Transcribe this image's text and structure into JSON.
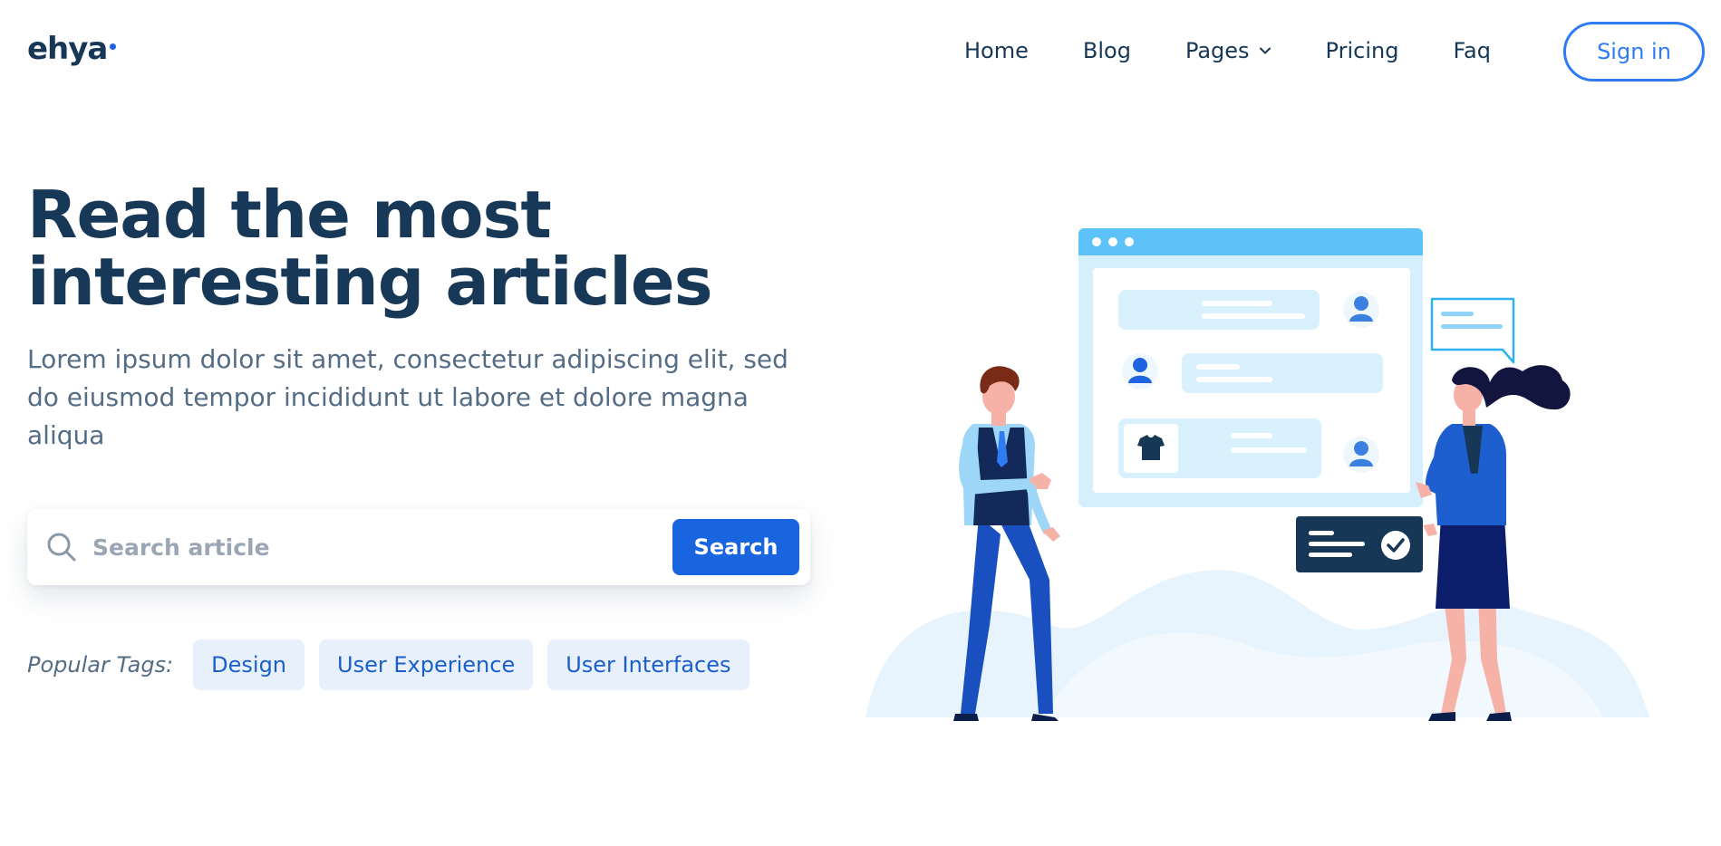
{
  "nav": {
    "logo": "ehya",
    "items": [
      {
        "label": "Home"
      },
      {
        "label": "Blog"
      },
      {
        "label": "Pages"
      },
      {
        "label": "Pricing"
      },
      {
        "label": "Faq"
      }
    ],
    "signin_label": "Sign in"
  },
  "hero": {
    "title_line1": "Read the most",
    "title_line2": "interesting articles",
    "description": "Lorem ipsum dolor sit amet, consectetur adipiscing elit, sed do eiusmod tempor incididunt ut labore et dolore magna aliqua",
    "search": {
      "placeholder": "Search article",
      "value": "",
      "button_label": "Search"
    },
    "tags_label": "Popular Tags:",
    "tags": [
      {
        "label": "Design"
      },
      {
        "label": "User Experience"
      },
      {
        "label": "User Interfaces"
      }
    ]
  },
  "colors": {
    "primary": "#1965e0",
    "heading": "#173857",
    "body_text": "#546c84",
    "tag_bg": "#e8f0fb",
    "accent_outline": "#2f7cf2"
  },
  "icons": {
    "search": "magnifier-icon",
    "dropdown": "chevron-down-icon"
  }
}
